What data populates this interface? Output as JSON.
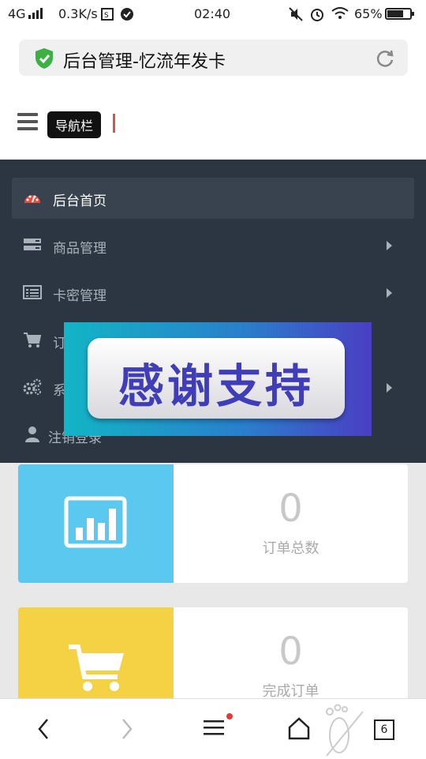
{
  "status_bar": {
    "network": "4G",
    "speed": "0.3K/s",
    "time": "02:40",
    "battery": "65%",
    "battery_level": 0.65
  },
  "browser": {
    "address_title": "后台管理-忆流年发卡",
    "tab_count": "6"
  },
  "header": {
    "tooltip": "导航栏"
  },
  "sidebar": {
    "items": [
      {
        "label": "后台首页",
        "icon": "dashboard-icon",
        "active": true
      },
      {
        "label": "商品管理",
        "icon": "server-icon"
      },
      {
        "label": "卡密管理",
        "icon": "list-card-icon"
      },
      {
        "label": "订",
        "icon": "cart-icon"
      },
      {
        "label": "系",
        "icon": "gears-icon"
      },
      {
        "label": "注销登录",
        "icon": "user-icon"
      }
    ]
  },
  "overlay": {
    "text": "感谢支持"
  },
  "cards": [
    {
      "value": "0",
      "label": "订单总数",
      "color": "#5bc8ef",
      "icon": "bar-chart-icon"
    },
    {
      "value": "0",
      "label": "完成订单",
      "color": "#f5d144",
      "icon": "cart-icon"
    }
  ],
  "colors": {
    "sidebar_bg": "#2c3642",
    "accent_red": "#e74c3c",
    "shield_green": "#3cb043"
  }
}
